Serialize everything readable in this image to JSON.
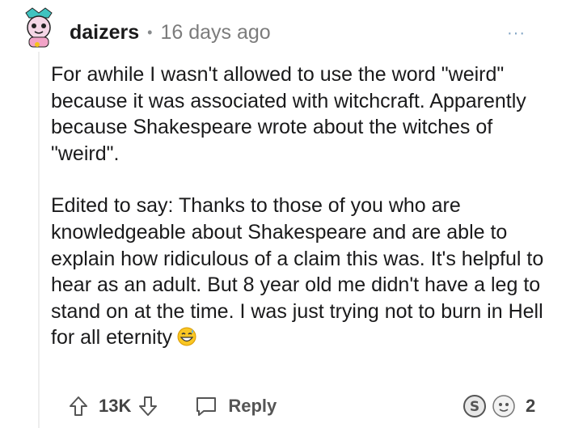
{
  "comment": {
    "username": "daizers",
    "separator": "•",
    "time": "16 days ago",
    "more_label": "···",
    "paragraphs": [
      "For awhile I wasn't allowed to use the word \"weird\" because it was associated with witchcraft. Apparently because Shakespeare wrote about the witches of \"weird\".",
      "Edited to say: Thanks to those of you who are knowledgeable about Shakespeare and are able to explain how ridiculous of a claim this was. It's helpful to hear as an adult. But 8 year old me didn't have a leg to stand on at the time. I was just trying not to burn in Hell for all eternity"
    ],
    "trailing_emoji": "grinning-sweat-emoji"
  },
  "actions": {
    "score": "13K",
    "reply_label": "Reply",
    "award_count": "2",
    "icons": [
      "upvote-icon",
      "downvote-icon",
      "reply-icon",
      "silver-award-icon",
      "helpful-award-icon"
    ]
  },
  "colors": {
    "username": "#1a1a1b",
    "meta": "#7c7c7c",
    "action": "#555555",
    "more": "#7a9fc0",
    "thread_line": "#ededed"
  }
}
